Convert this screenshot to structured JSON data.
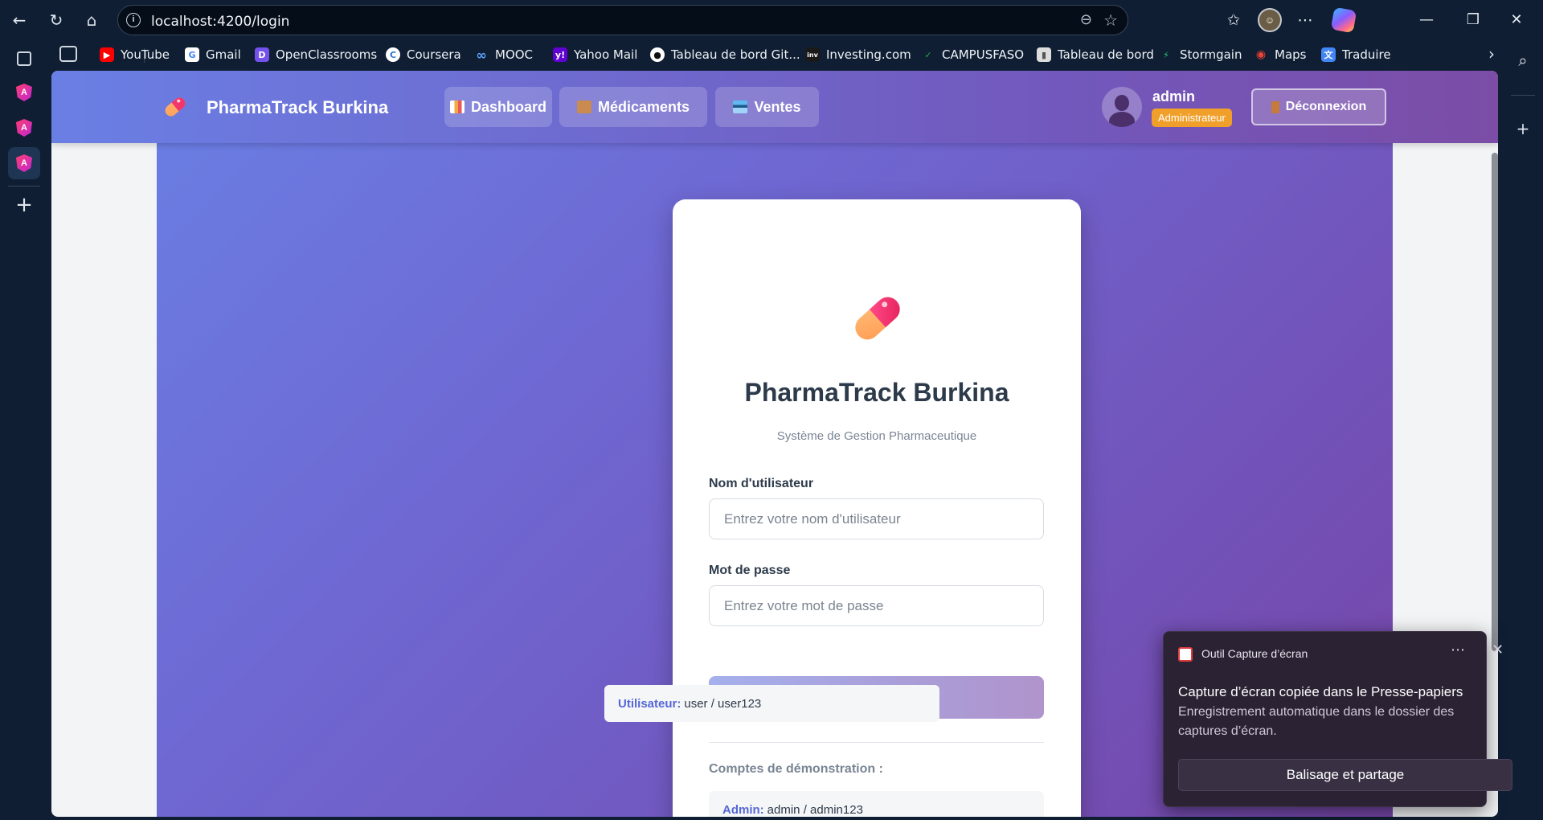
{
  "browser": {
    "url": "localhost:4200/login",
    "bookmarks": [
      {
        "label": "YouTube",
        "color": "#ff0000",
        "glyph": "▶"
      },
      {
        "label": "Gmail",
        "color": "#ffffff",
        "glyph": "G"
      },
      {
        "label": "OpenClassrooms",
        "color": "#7451eb",
        "glyph": "D"
      },
      {
        "label": "Coursera",
        "color": "#2a73cc",
        "glyph": "C"
      },
      {
        "label": "MOOC",
        "color": "#1f7ae0",
        "glyph": "∞"
      },
      {
        "label": "Yahoo Mail",
        "color": "#6001d2",
        "glyph": "y!"
      },
      {
        "label": "Tableau de bord Git...",
        "color": "#ffffff",
        "glyph": "●"
      },
      {
        "label": "Investing.com",
        "color": "#1a1a1a",
        "glyph": "inv"
      },
      {
        "label": "CAMPUSFASO",
        "color": "#2aa84a",
        "glyph": "✓"
      },
      {
        "label": "Tableau de bord",
        "color": "#dddddd",
        "glyph": "▮"
      },
      {
        "label": "Stormgain",
        "color": "#28c76f",
        "glyph": "⚡"
      },
      {
        "label": "Maps",
        "color": "#34a853",
        "glyph": "◉"
      },
      {
        "label": "Traduire",
        "color": "#4285f4",
        "glyph": "文"
      }
    ]
  },
  "header": {
    "brand": "PharmaTrack Burkina",
    "nav": [
      {
        "label": "Dashboard",
        "icon": "bar-chart-icon",
        "color": "#f4a942"
      },
      {
        "label": "Médicaments",
        "icon": "package-icon",
        "color": "#c98b4f"
      },
      {
        "label": "Ventes",
        "icon": "credit-card-icon",
        "color": "#5fb8f0"
      }
    ],
    "user": {
      "name": "admin",
      "role": "Administrateur"
    },
    "logout_label": "Déconnexion"
  },
  "login": {
    "title": "PharmaTrack Burkina",
    "subtitle": "Système de Gestion Pharmaceutique",
    "username_label": "Nom d'utilisateur",
    "username_placeholder": "Entrez votre nom d'utilisateur",
    "password_label": "Mot de passe",
    "password_placeholder": "Entrez votre mot de passe",
    "submit_label": "Se connecter",
    "demo_title": "Comptes de démonstration :",
    "demo_accounts": [
      {
        "role": "Admin:",
        "creds": "admin / admin123"
      },
      {
        "role": "Utilisateur:",
        "creds": "user / user123"
      }
    ]
  },
  "toast": {
    "app": "Outil Capture d’écran",
    "title": "Capture d’écran copiée dans le Presse-papiers",
    "body": "Enregistrement automatique dans le dossier des captures d’écran.",
    "action": "Balisage et partage"
  },
  "colors": {
    "accent": "#6a7fe4",
    "accent2": "#7b4da6",
    "badge": "#f0a02a",
    "link": "#5567d6"
  }
}
